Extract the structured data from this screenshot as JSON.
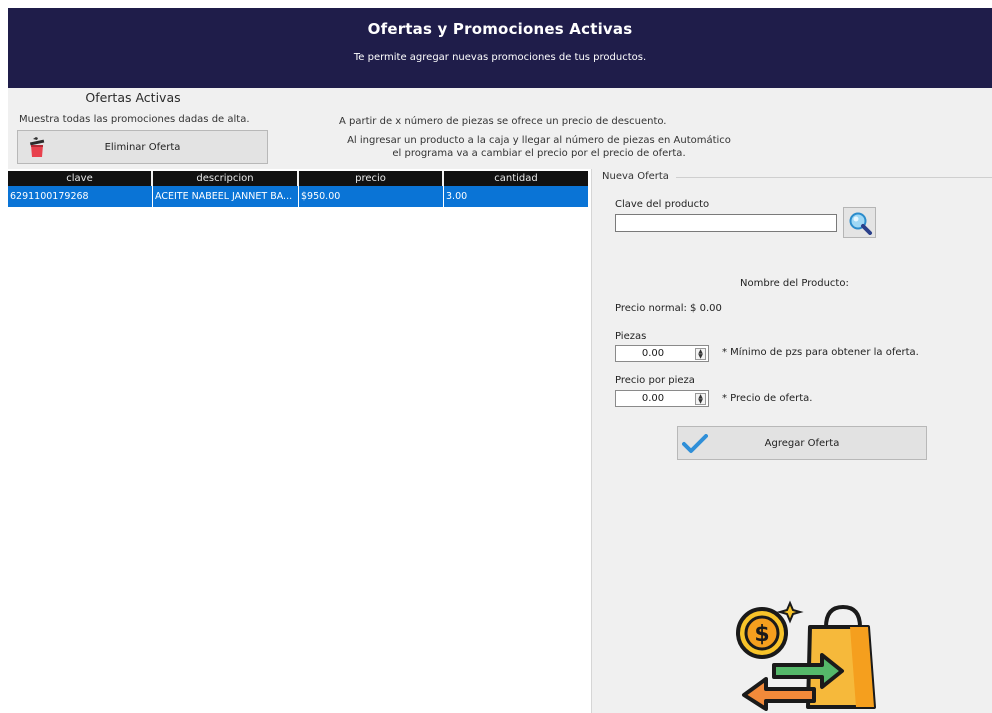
{
  "header": {
    "title": "Ofertas y Promociones Activas",
    "subtitle": "Te permite agregar nuevas promociones de tus productos."
  },
  "left": {
    "title": "Ofertas Activas",
    "subtitle": "Muestra todas las promociones dadas de alta.",
    "delete_button": "Eliminar Oferta"
  },
  "info": {
    "line1": "A partir de x número de piezas se ofrece un precio de descuento.",
    "line2": "Al ingresar un producto a la caja y llegar al  número de piezas en Automático",
    "line3": "el programa va a cambiar el precio por el precio de oferta."
  },
  "table": {
    "columns": [
      "clave",
      "descripcion",
      "precio",
      "cantidad"
    ],
    "rows": [
      {
        "clave": "6291100179268",
        "descripcion": "ACEITE NABEEL JANNET BA...",
        "precio": "$950.00",
        "cantidad": "3.00"
      }
    ]
  },
  "form": {
    "group_title": "Nueva Oferta",
    "clave_label": "Clave del producto",
    "clave_value": "",
    "product_name_label": "Nombre del Producto:",
    "precio_normal": "Precio normal: $ 0.00",
    "piezas_label": "Piezas",
    "piezas_value": "0.00",
    "piezas_hint": "* Mínimo de pzs para obtener la oferta.",
    "precio_pieza_label": "Precio por pieza",
    "precio_pieza_value": "0.00",
    "precio_pieza_hint": "* Precio de oferta.",
    "add_button": "Agregar Oferta"
  },
  "icons": {
    "delete": "trash-icon",
    "search": "magnifier-icon",
    "add": "checkmark-icon",
    "illustration": "discount-offer-illustration"
  },
  "colors": {
    "header_bg": "#1f1d4a",
    "selected_row": "#0a74d6",
    "table_header": "#111111",
    "panel_bg": "#f0f0f0"
  }
}
